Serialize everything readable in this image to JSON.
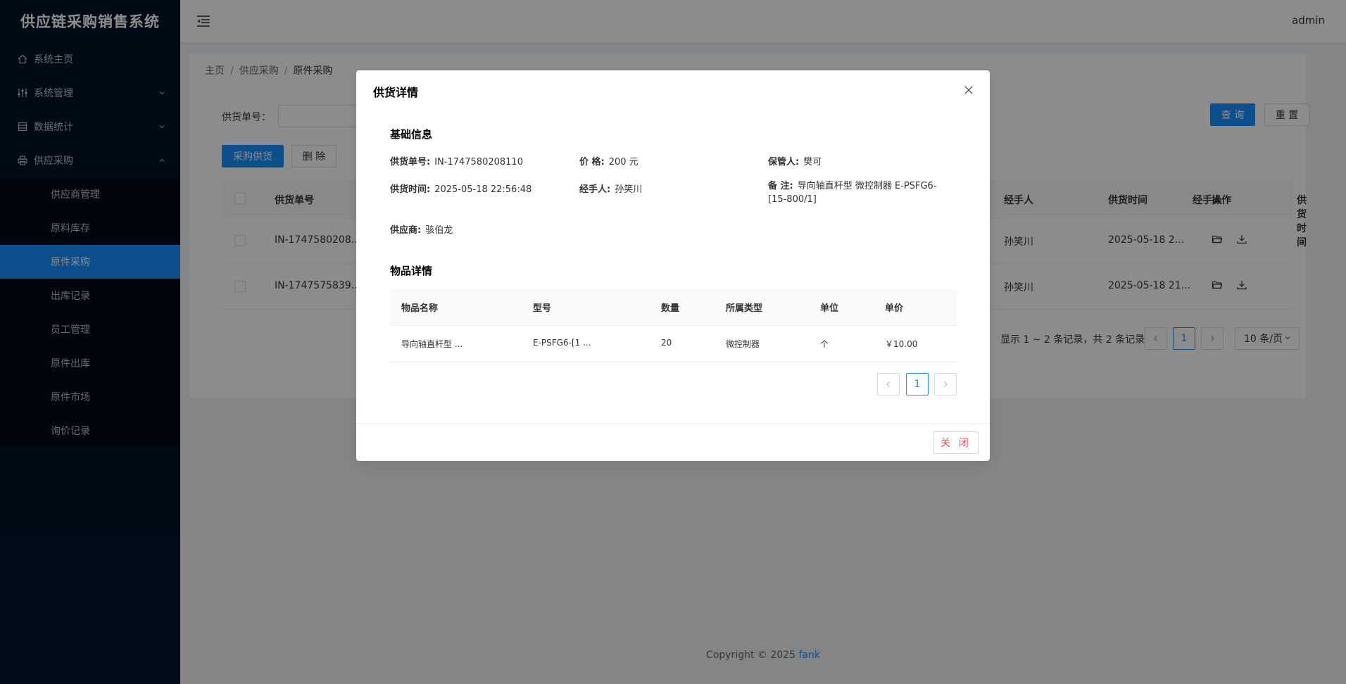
{
  "app": {
    "title": "供应链采购销售系统",
    "user": "admin"
  },
  "sidebar": {
    "items": [
      {
        "label": "系统主页",
        "icon": "home-icon"
      },
      {
        "label": "系统管理",
        "icon": "settings-icon"
      },
      {
        "label": "数据统计",
        "icon": "stats-icon"
      },
      {
        "label": "供应采购",
        "icon": "printer-icon"
      }
    ],
    "submenu": [
      {
        "label": "供应商管理"
      },
      {
        "label": "原料库存"
      },
      {
        "label": "原件采购",
        "active": true
      },
      {
        "label": "出库记录"
      },
      {
        "label": "员工管理"
      },
      {
        "label": "原件出库"
      },
      {
        "label": "原件市场"
      },
      {
        "label": "询价记录"
      }
    ]
  },
  "breadcrumb": {
    "home": "主页",
    "parent": "供应采购",
    "current": "原件采购"
  },
  "search": {
    "label": "供货单号：",
    "query": "查 询",
    "reset": "重 置"
  },
  "actions": {
    "purchase": "采购供货",
    "delete": "删 除"
  },
  "table": {
    "headers": {
      "no": "供货单号",
      "handler": "经手人",
      "time": "供货时间",
      "ops": "操作"
    },
    "rows": [
      {
        "no": "IN-1747580208...",
        "handler": "孙笑川",
        "time": "2025-05-18 2..."
      },
      {
        "no": "IN-1747575839...",
        "handler": "孙笑川",
        "time": "2025-05-18 21..."
      }
    ],
    "summary": "显示 1 ~ 2 条记录，共 2 条记录",
    "page": "1",
    "page_size": "10 条/页"
  },
  "footer": {
    "text": "Copyright © 2025 ",
    "link": "fank"
  },
  "modal": {
    "title": "供货详情",
    "basic_title": "基础信息",
    "fields": {
      "no_label": "供货单号:",
      "no": "IN-1747580208110",
      "price_label": "价 格:",
      "price": "200 元",
      "keeper_label": "保管人:",
      "keeper": "樊可",
      "time_label": "供货时间:",
      "time": "2025-05-18 22:56:48",
      "handler_label": "经手人:",
      "handler": "孙笑川",
      "remark_label": "备 注:",
      "remark": "导向轴直杆型 微控制器 E-PSFG6-[15-800/1]",
      "supplier_label": "供应商:",
      "supplier": "骇伯龙"
    },
    "items_title": "物品详情",
    "items": {
      "headers": {
        "name": "物品名称",
        "model": "型号",
        "qty": "数量",
        "type": "所属类型",
        "unit": "单位",
        "price": "单价"
      },
      "rows": [
        {
          "name": "导向轴直杆型 ...",
          "model": "E-PSFG6-[1 ...",
          "qty": "20",
          "type": "微控制器",
          "unit": "个",
          "price": "￥10.00"
        }
      ]
    },
    "page": "1",
    "close": "关 闭"
  },
  "colors": {
    "primary": "#1890ff",
    "sidebar": "#001529",
    "danger": "#ff4d4f"
  }
}
